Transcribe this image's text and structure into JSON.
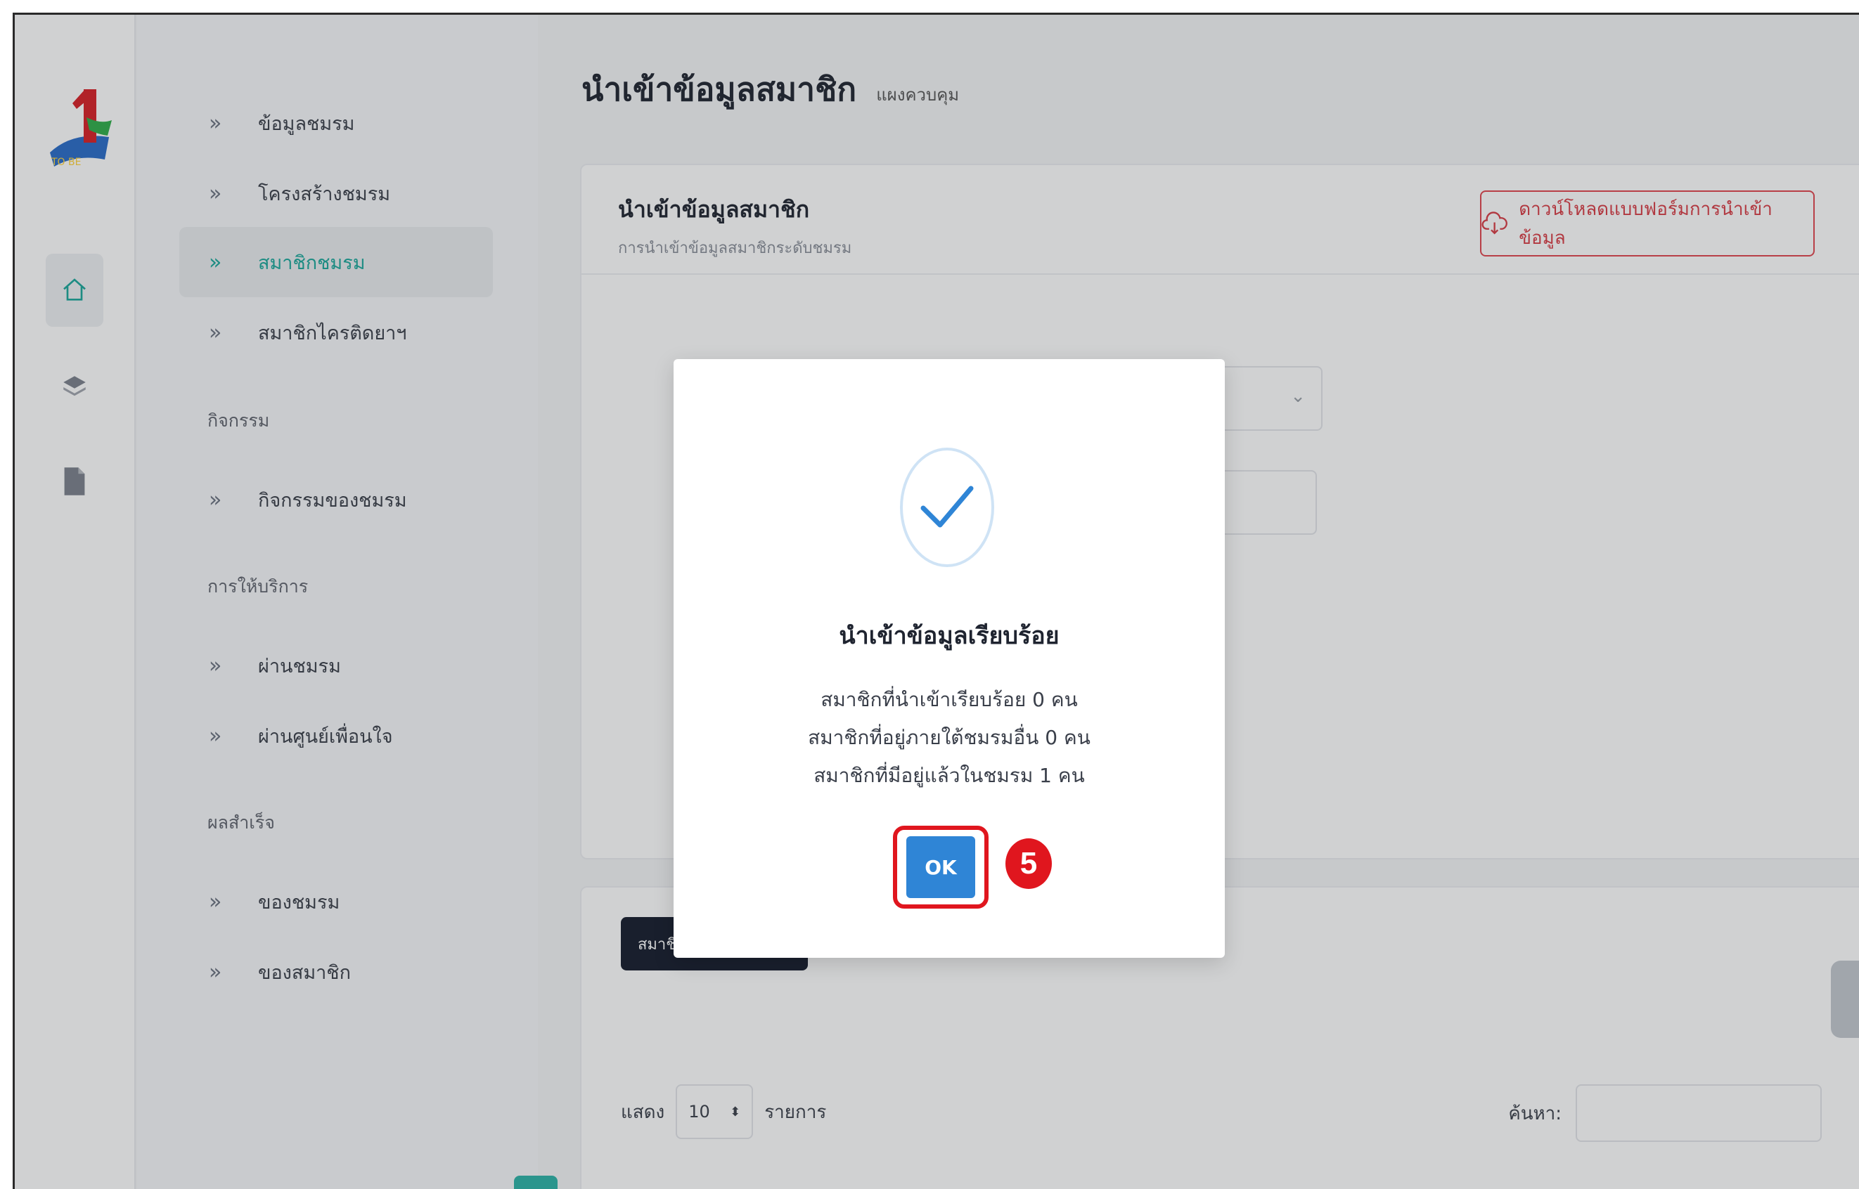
{
  "sidebar": {
    "items": [
      {
        "label": "ข้อมูลชมรม"
      },
      {
        "label": "โครงสร้างชมรม"
      },
      {
        "label": "สมาชิกชมรม",
        "active": true
      },
      {
        "label": "สมาชิกไครติดยาฯ"
      }
    ],
    "sections": [
      {
        "title": "กิจกรรม",
        "items": [
          {
            "label": "กิจกรรมของชมรม"
          }
        ]
      },
      {
        "title": "การให้บริการ",
        "items": [
          {
            "label": "ผ่านชมรม"
          },
          {
            "label": "ผ่านศูนย์เพื่อนใจ"
          }
        ]
      },
      {
        "title": "ผลสำเร็จ",
        "items": [
          {
            "label": "ของชมรม"
          },
          {
            "label": "ของสมาชิก"
          }
        ]
      }
    ]
  },
  "rail": {
    "icons": [
      "home-icon",
      "layers-icon",
      "file-icon"
    ],
    "logo_text": "1"
  },
  "header": {
    "title": "นำเข้าข้อมูลสมาชิก",
    "subtitle": "แผงควบคุม"
  },
  "import_card": {
    "title": "นำเข้าข้อมูลสมาชิก",
    "description": "การนำเข้าข้อมูลสมาชิกระดับชมรม",
    "download_button": "ดาวน์โหลดแบบฟอร์มการนำเข้าข้อมูล"
  },
  "members_card": {
    "tab_label": "สมาชิก",
    "show_label": "แสดง",
    "page_length": "10",
    "entries_label": "รายการ",
    "search_label": "ค้นหา:"
  },
  "modal": {
    "title": "นำเข้าข้อมูลเรียบร้อย",
    "line1": "สมาชิกที่นำเข้าเรียบร้อย 0 คน",
    "line2": "สมาชิกที่อยู่ภายใต้ชมรมอื่น 0 คน",
    "line3": "สมาชิกที่มีอยู่แล้วในชมรม 1 คน",
    "ok_label": "OK",
    "step_number": "5"
  },
  "colors": {
    "accent": "#1aa79a",
    "danger": "#d83b44",
    "primary": "#2f85d6",
    "annotation": "#e0161e"
  }
}
